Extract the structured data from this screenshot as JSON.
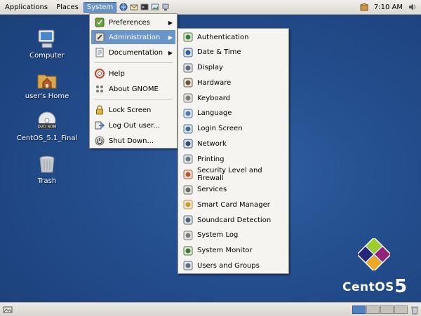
{
  "top_panel": {
    "menus": [
      {
        "label": "Applications"
      },
      {
        "label": "Places"
      },
      {
        "label": "System"
      }
    ],
    "launcher_icons": [
      "browser-icon",
      "mail-icon",
      "terminal-icon",
      "image-icon",
      "network-icon"
    ],
    "clock": "7:10 AM"
  },
  "desktop_icons": [
    {
      "label": "Computer",
      "icon": "computer-icon"
    },
    {
      "label": "user's Home",
      "icon": "home-folder-icon"
    },
    {
      "label": "CentOS_5.1_Final",
      "icon": "dvd-rom-icon",
      "badge": "DVD ROM"
    },
    {
      "label": "Trash",
      "icon": "trash-icon"
    }
  ],
  "system_menu": {
    "items": [
      {
        "label": "Preferences",
        "submenu": true,
        "icon": "preferences-icon"
      },
      {
        "label": "Administration",
        "submenu": true,
        "icon": "administration-icon"
      },
      {
        "label": "Documentation",
        "submenu": true,
        "icon": "documentation-icon"
      },
      {
        "label": "Help",
        "icon": "help-icon"
      },
      {
        "label": "About GNOME",
        "icon": "gnome-foot-icon"
      },
      {
        "label": "Lock Screen",
        "icon": "lock-icon"
      },
      {
        "label": "Log Out user...",
        "icon": "logout-icon"
      },
      {
        "label": "Shut Down...",
        "icon": "power-icon"
      }
    ]
  },
  "admin_menu": {
    "items": [
      {
        "label": "Authentication",
        "icon": "authentication-icon"
      },
      {
        "label": "Date & Time",
        "icon": "clock-icon"
      },
      {
        "label": "Display",
        "icon": "display-icon"
      },
      {
        "label": "Hardware",
        "icon": "hardware-icon"
      },
      {
        "label": "Keyboard",
        "icon": "keyboard-icon"
      },
      {
        "label": "Language",
        "icon": "language-icon"
      },
      {
        "label": "Login Screen",
        "icon": "login-screen-icon"
      },
      {
        "label": "Network",
        "icon": "network-icon"
      },
      {
        "label": "Printing",
        "icon": "printer-icon"
      },
      {
        "label": "Security Level and Firewall",
        "icon": "firewall-icon"
      },
      {
        "label": "Services",
        "icon": "services-icon"
      },
      {
        "label": "Smart Card Manager",
        "icon": "smart-card-icon"
      },
      {
        "label": "Soundcard Detection",
        "icon": "soundcard-icon"
      },
      {
        "label": "System Log",
        "icon": "system-log-icon"
      },
      {
        "label": "System Monitor",
        "icon": "system-monitor-icon"
      },
      {
        "label": "Users and Groups",
        "icon": "users-groups-icon"
      }
    ]
  },
  "branding": {
    "text": "CentOS",
    "version": "5"
  },
  "colors": {
    "desktop": "#234d8c",
    "highlight": "#6a95c9",
    "menu_bg": "#f6f4f1"
  }
}
